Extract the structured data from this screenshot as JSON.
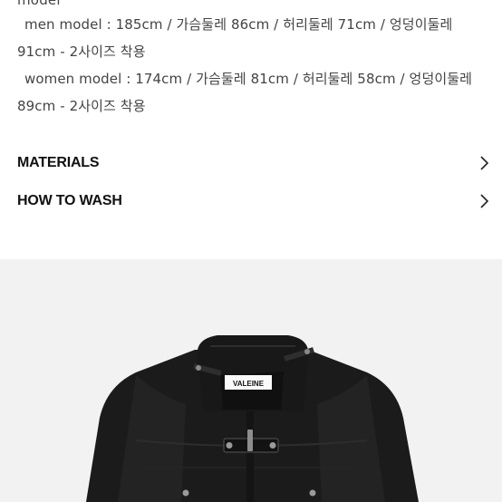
{
  "size_info": {
    "cut_line": "model",
    "men_line": "men model : 185cm / 가슴둘레 86cm / 허리둘레 71cm /  엉덩이둘레",
    "men_line_cont": "91cm - 2사이즈 착용",
    "women_line": "women model : 174cm / 가슴둘레 81cm / 허리둘레 58cm / 엉덩이둘레",
    "women_line_cont": "89cm - 2사이즈 착용"
  },
  "accordion": {
    "materials_label": "MATERIALS",
    "wash_label": "HOW TO WASH",
    "chevron_icon": "chevron-right-icon"
  },
  "product_image": {
    "label_text": "VALEINE",
    "background": "#f2f2f2",
    "jacket_color": "#1b1b1b"
  }
}
